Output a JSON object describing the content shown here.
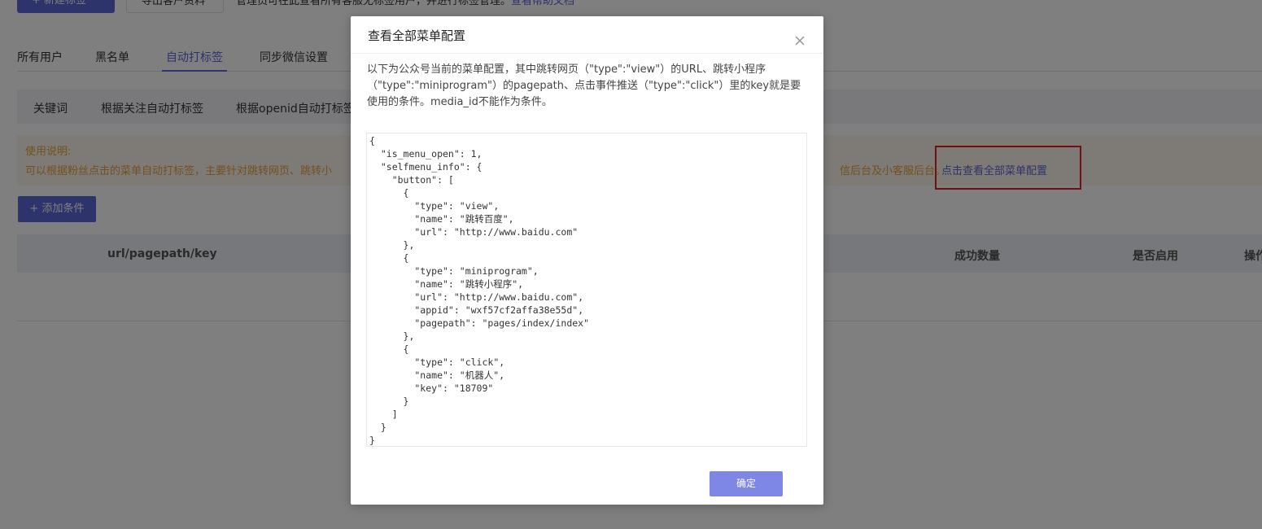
{
  "top_bar": {
    "new_tag_button": "+ 新建标签",
    "export_button": "导出客户资料",
    "note": "管理员可在此查看所有客服无标签用户，并进行标签管理。",
    "help_link": "查看帮助文档"
  },
  "main_tabs": [
    {
      "label": "所有用户"
    },
    {
      "label": "黑名单"
    },
    {
      "label": "自动打标签"
    },
    {
      "label": "同步微信设置"
    }
  ],
  "sub_tabs": [
    {
      "label": "关键词"
    },
    {
      "label": "根据关注自动打标签"
    },
    {
      "label": "根据openid自动打标签"
    }
  ],
  "notice": {
    "title": "使用说明:",
    "text": "可以根据粉丝点击的菜单自动打标签，主要针对跳转网页、跳转小",
    "tail": "信后台及小客服后台。",
    "link": "点击查看全部菜单配置"
  },
  "add_button": "+ 添加条件",
  "table": {
    "col_url": "url/pagepath/key",
    "col_success": "成功数量",
    "col_enabled": "是否启用",
    "col_ops": "操作"
  },
  "dialog": {
    "title": "查看全部菜单配置",
    "description": "以下为公众号当前的菜单配置，其中跳转网页（\"type\":\"view\"）的URL、跳转小程序（\"type\":\"miniprogram\"）的pagepath、点击事件推送（\"type\":\"click\"）里的key就是要使用的条件。media_id不能作为条件。",
    "code": "{\n  \"is_menu_open\": 1,\n  \"selfmenu_info\": {\n    \"button\": [\n      {\n        \"type\": \"view\",\n        \"name\": \"跳转百度\",\n        \"url\": \"http://www.baidu.com\"\n      },\n      {\n        \"type\": \"miniprogram\",\n        \"name\": \"跳转小程序\",\n        \"url\": \"http://www.baidu.com\",\n        \"appid\": \"wxf57cf2affa38e55d\",\n        \"pagepath\": \"pages/index/index\"\n      },\n      {\n        \"type\": \"click\",\n        \"name\": \"机器人\",\n        \"key\": \"18709\"\n      }\n    ]\n  }\n}",
    "ok_button": "确定"
  },
  "colors": {
    "accent": "#5b66d6",
    "notice_text": "#e6a23c",
    "highlight_box": "#e02020"
  }
}
